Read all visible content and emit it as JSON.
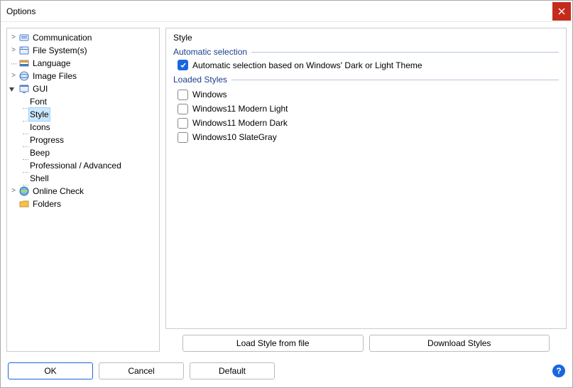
{
  "window": {
    "title": "Options"
  },
  "tree": {
    "communication": "Communication",
    "filesystems": "File System(s)",
    "language": "Language",
    "imagefiles": "Image Files",
    "gui": "GUI",
    "gui_children": {
      "font": "Font",
      "style": "Style",
      "icons": "Icons",
      "progress": "Progress",
      "beep": "Beep",
      "pro": "Professional / Advanced",
      "shell": "Shell"
    },
    "onlinecheck": "Online Check",
    "folders": "Folders"
  },
  "panel": {
    "title": "Style",
    "group_auto": "Automatic selection",
    "auto_label": "Automatic selection based on Windows' Dark or Light Theme",
    "group_loaded": "Loaded Styles",
    "styles": [
      "Windows",
      "Windows11 Modern Light",
      "Windows11 Modern Dark",
      "Windows10 SlateGray"
    ]
  },
  "buttons": {
    "load": "Load Style from file",
    "download": "Download Styles",
    "ok": "OK",
    "cancel": "Cancel",
    "default": "Default"
  }
}
